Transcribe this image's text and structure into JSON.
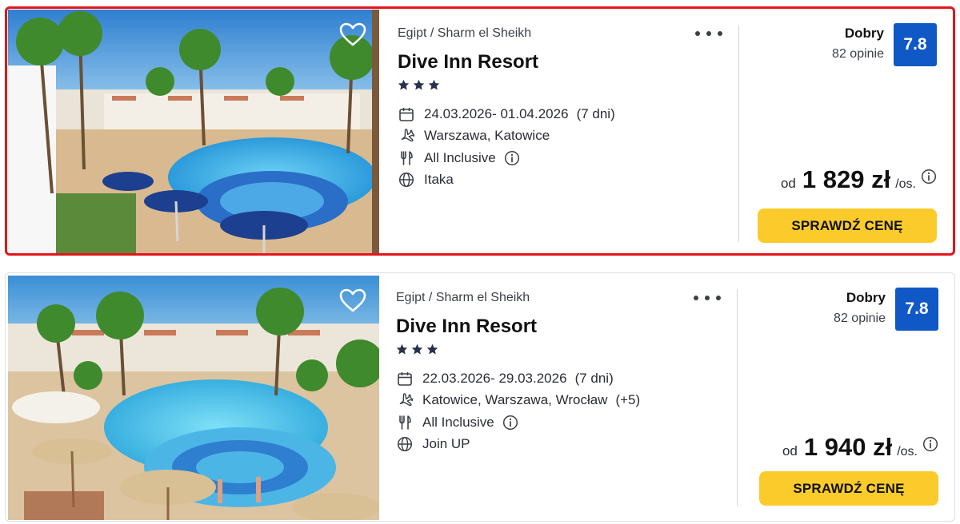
{
  "offers": [
    {
      "breadcrumb": "Egipt / Sharm el Sheikh",
      "name": "Dive Inn Resort",
      "stars": 3,
      "dates": "24.03.2026- 01.04.2026",
      "duration": "(7 dni)",
      "departure": "Warszawa, Katowice",
      "departure_extra": "",
      "board": "All Inclusive",
      "operator": "Itaka",
      "rating_label": "Dobry",
      "rating_count": "82 opinie",
      "rating_score": "7.8",
      "price_prefix": "od",
      "price": "1 829 zł",
      "price_suffix": "/os.",
      "cta_label": "SPRAWDŹ CENĘ",
      "selected": true
    },
    {
      "breadcrumb": "Egipt / Sharm el Sheikh",
      "name": "Dive Inn Resort",
      "stars": 3,
      "dates": "22.03.2026- 29.03.2026",
      "duration": "(7 dni)",
      "departure": "Katowice, Warszawa, Wrocław",
      "departure_extra": "(+5)",
      "board": "All Inclusive",
      "operator": "Join UP",
      "rating_label": "Dobry",
      "rating_count": "82 opinie",
      "rating_score": "7.8",
      "price_prefix": "od",
      "price": "1 940 zł",
      "price_suffix": "/os.",
      "cta_label": "SPRAWDŹ CENĘ",
      "selected": false
    }
  ],
  "colors": {
    "accent_button": "#fbcb2b",
    "rating_badge": "#1058c6",
    "selection_border": "#e3151b"
  },
  "icons": [
    "heart-icon",
    "more-dots-icon",
    "star-icon",
    "calendar-icon",
    "plane-icon",
    "cutlery-icon",
    "info-icon",
    "globe-icon"
  ]
}
